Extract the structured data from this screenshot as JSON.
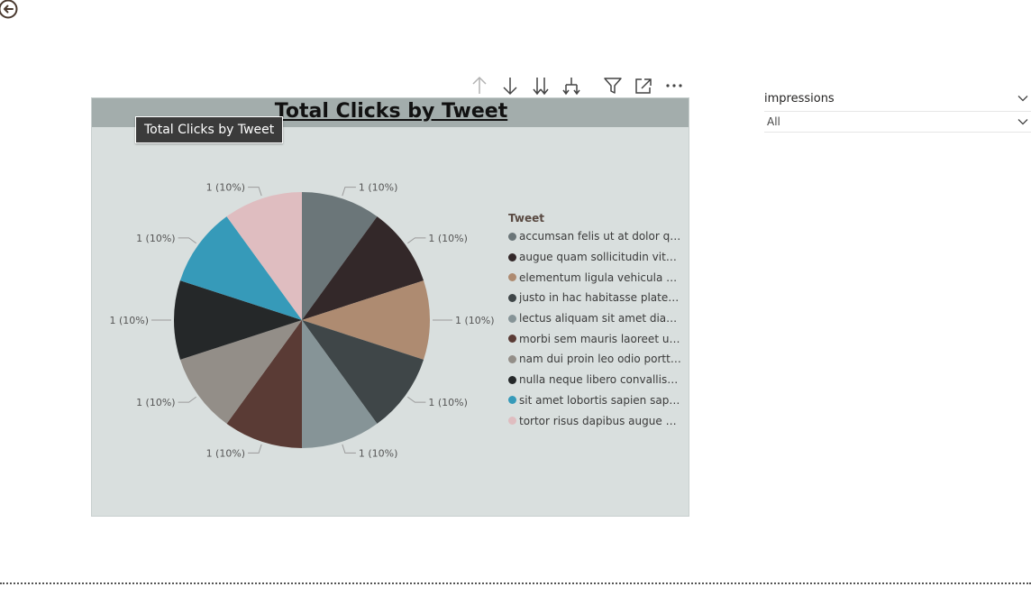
{
  "visual": {
    "title": "Total Clicks by Tweet",
    "tooltip": "Total Clicks by Tweet"
  },
  "legend": {
    "title": "Tweet"
  },
  "slicer": {
    "title": "impressions",
    "selected": "All"
  },
  "icons": {
    "back": "back-arrow-circle-icon",
    "drill_up": "arrow-up-icon",
    "drill_down": "arrow-down-icon",
    "expand_next_level": "double-arrow-down-icon",
    "expand_all": "fork-down-icon",
    "filter": "filter-icon",
    "focus_mode": "focus-mode-icon",
    "more_options": "more-options-icon",
    "chevron": "chevron-down-icon"
  },
  "chart_data": {
    "type": "pie",
    "title": "Total Clicks by Tweet",
    "legend_title": "Tweet",
    "legend_position": "right",
    "categories": [
      "accumsan felis ut at dolor quis ...",
      "augue quam sollicitudin vitae c...",
      "elementum ligula vehicula con...",
      "justo in hac habitasse platea di...",
      "lectus aliquam sit amet diam in...",
      "morbi sem mauris laoreet ut rh...",
      "nam dui proin leo odio porttito...",
      "nulla neque libero convallis eg...",
      "sit amet lobortis sapien sapien ...",
      "tortor risus dapibus augue vel ..."
    ],
    "values": [
      1,
      1,
      1,
      1,
      1,
      1,
      1,
      1,
      1,
      1
    ],
    "data_labels": [
      "1 (10%)",
      "1 (10%)",
      "1 (10%)",
      "1 (10%)",
      "1 (10%)",
      "1 (10%)",
      "1 (10%)",
      "1 (10%)",
      "1 (10%)",
      "1 (10%)"
    ],
    "colors": [
      "#6b7679",
      "#332829",
      "#ae8b71",
      "#3f4648",
      "#869497",
      "#5a3b35",
      "#938e88",
      "#252829",
      "#369ab9",
      "#dfbdc0"
    ]
  }
}
